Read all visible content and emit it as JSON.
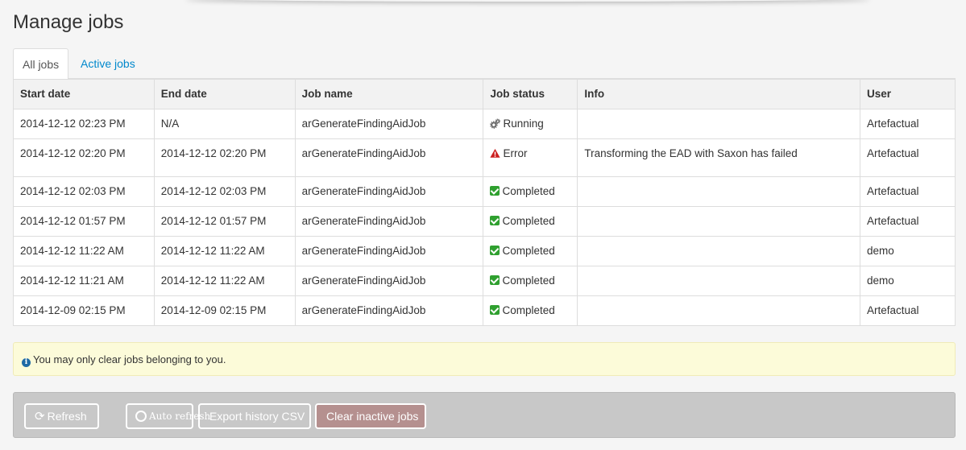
{
  "page": {
    "title": "Manage jobs"
  },
  "tabs": [
    {
      "label": "All jobs",
      "active": true
    },
    {
      "label": "Active jobs",
      "active": false
    }
  ],
  "table": {
    "headers": [
      "Start date",
      "End date",
      "Job name",
      "Job status",
      "Info",
      "User"
    ],
    "rows": [
      {
        "start": "2014-12-12 02:23 PM",
        "end": "N/A",
        "name": "arGenerateFindingAidJob",
        "status": "Running",
        "status_icon": "gears-icon",
        "info": "",
        "user": "Artefactual"
      },
      {
        "start": "2014-12-12 02:20 PM",
        "end": "2014-12-12 02:20 PM",
        "name": "arGenerateFindingAidJob",
        "status": "Error",
        "status_icon": "warning-icon",
        "info": "Transforming the EAD with Saxon has failed",
        "user": "Artefactual"
      },
      {
        "start": "2014-12-12 02:03 PM",
        "end": "2014-12-12 02:03 PM",
        "name": "arGenerateFindingAidJob",
        "status": "Completed",
        "status_icon": "check-icon",
        "info": "",
        "user": "Artefactual"
      },
      {
        "start": "2014-12-12 01:57 PM",
        "end": "2014-12-12 01:57 PM",
        "name": "arGenerateFindingAidJob",
        "status": "Completed",
        "status_icon": "check-icon",
        "info": "",
        "user": "Artefactual"
      },
      {
        "start": "2014-12-12 11:22 AM",
        "end": "2014-12-12 11:22 AM",
        "name": "arGenerateFindingAidJob",
        "status": "Completed",
        "status_icon": "check-icon",
        "info": "",
        "user": "demo"
      },
      {
        "start": "2014-12-12 11:21 AM",
        "end": "2014-12-12 11:22 AM",
        "name": "arGenerateFindingAidJob",
        "status": "Completed",
        "status_icon": "check-icon",
        "info": "",
        "user": "demo"
      },
      {
        "start": "2014-12-09 02:15 PM",
        "end": "2014-12-09 02:15 PM",
        "name": "arGenerateFindingAidJob",
        "status": "Completed",
        "status_icon": "check-icon",
        "info": "",
        "user": "Artefactual"
      }
    ]
  },
  "notice": {
    "text": "You may only clear jobs belonging to you."
  },
  "actions": {
    "refresh_label": "Refresh",
    "auto_refresh_label": "Auto refresh",
    "export_label": "Export history CSV",
    "clear_label": "Clear inactive jobs"
  },
  "colors": {
    "link": "#0088cc",
    "error": "#cc1f1f",
    "success": "#2fa02f",
    "notice_bg": "#fcfbd9",
    "actions_bg": "#c8c8c8",
    "clear_button_bg": "#b5908f"
  }
}
